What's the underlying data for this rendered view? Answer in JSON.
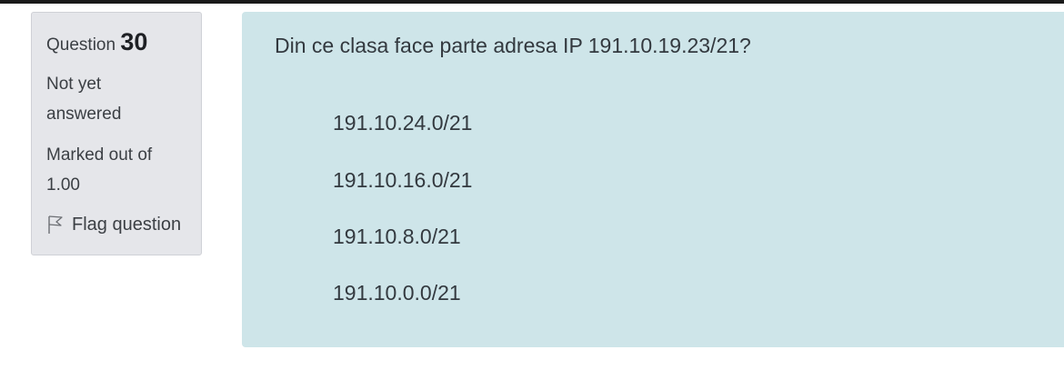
{
  "info": {
    "question_label": "Question",
    "question_number": "30",
    "state_line1": "Not yet",
    "state_line2": "answered",
    "grade_line1": "Marked out of",
    "grade_line2": "1.00",
    "flag_label": "Flag question"
  },
  "question": {
    "text": "Din ce clasa face parte adresa IP 191.10.19.23/21?",
    "answers": [
      "191.10.24.0/21",
      "191.10.16.0/21",
      "191.10.8.0/21",
      "191.10.0.0/21"
    ]
  },
  "icons": {
    "flag": "flag-outline-icon"
  },
  "colors": {
    "info_background": "#e5e6ea",
    "content_background": "#cee5e9",
    "top_rule": "#1a1a1a"
  }
}
